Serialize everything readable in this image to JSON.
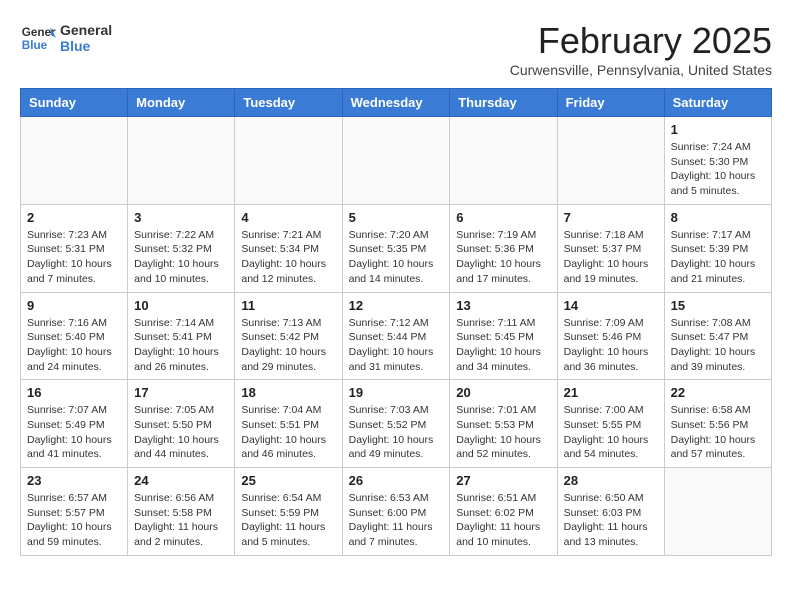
{
  "header": {
    "logo_general": "General",
    "logo_blue": "Blue",
    "month_title": "February 2025",
    "location": "Curwensville, Pennsylvania, United States"
  },
  "days_of_week": [
    "Sunday",
    "Monday",
    "Tuesday",
    "Wednesday",
    "Thursday",
    "Friday",
    "Saturday"
  ],
  "weeks": [
    [
      {
        "num": "",
        "info": ""
      },
      {
        "num": "",
        "info": ""
      },
      {
        "num": "",
        "info": ""
      },
      {
        "num": "",
        "info": ""
      },
      {
        "num": "",
        "info": ""
      },
      {
        "num": "",
        "info": ""
      },
      {
        "num": "1",
        "info": "Sunrise: 7:24 AM\nSunset: 5:30 PM\nDaylight: 10 hours and 5 minutes."
      }
    ],
    [
      {
        "num": "2",
        "info": "Sunrise: 7:23 AM\nSunset: 5:31 PM\nDaylight: 10 hours and 7 minutes."
      },
      {
        "num": "3",
        "info": "Sunrise: 7:22 AM\nSunset: 5:32 PM\nDaylight: 10 hours and 10 minutes."
      },
      {
        "num": "4",
        "info": "Sunrise: 7:21 AM\nSunset: 5:34 PM\nDaylight: 10 hours and 12 minutes."
      },
      {
        "num": "5",
        "info": "Sunrise: 7:20 AM\nSunset: 5:35 PM\nDaylight: 10 hours and 14 minutes."
      },
      {
        "num": "6",
        "info": "Sunrise: 7:19 AM\nSunset: 5:36 PM\nDaylight: 10 hours and 17 minutes."
      },
      {
        "num": "7",
        "info": "Sunrise: 7:18 AM\nSunset: 5:37 PM\nDaylight: 10 hours and 19 minutes."
      },
      {
        "num": "8",
        "info": "Sunrise: 7:17 AM\nSunset: 5:39 PM\nDaylight: 10 hours and 21 minutes."
      }
    ],
    [
      {
        "num": "9",
        "info": "Sunrise: 7:16 AM\nSunset: 5:40 PM\nDaylight: 10 hours and 24 minutes."
      },
      {
        "num": "10",
        "info": "Sunrise: 7:14 AM\nSunset: 5:41 PM\nDaylight: 10 hours and 26 minutes."
      },
      {
        "num": "11",
        "info": "Sunrise: 7:13 AM\nSunset: 5:42 PM\nDaylight: 10 hours and 29 minutes."
      },
      {
        "num": "12",
        "info": "Sunrise: 7:12 AM\nSunset: 5:44 PM\nDaylight: 10 hours and 31 minutes."
      },
      {
        "num": "13",
        "info": "Sunrise: 7:11 AM\nSunset: 5:45 PM\nDaylight: 10 hours and 34 minutes."
      },
      {
        "num": "14",
        "info": "Sunrise: 7:09 AM\nSunset: 5:46 PM\nDaylight: 10 hours and 36 minutes."
      },
      {
        "num": "15",
        "info": "Sunrise: 7:08 AM\nSunset: 5:47 PM\nDaylight: 10 hours and 39 minutes."
      }
    ],
    [
      {
        "num": "16",
        "info": "Sunrise: 7:07 AM\nSunset: 5:49 PM\nDaylight: 10 hours and 41 minutes."
      },
      {
        "num": "17",
        "info": "Sunrise: 7:05 AM\nSunset: 5:50 PM\nDaylight: 10 hours and 44 minutes."
      },
      {
        "num": "18",
        "info": "Sunrise: 7:04 AM\nSunset: 5:51 PM\nDaylight: 10 hours and 46 minutes."
      },
      {
        "num": "19",
        "info": "Sunrise: 7:03 AM\nSunset: 5:52 PM\nDaylight: 10 hours and 49 minutes."
      },
      {
        "num": "20",
        "info": "Sunrise: 7:01 AM\nSunset: 5:53 PM\nDaylight: 10 hours and 52 minutes."
      },
      {
        "num": "21",
        "info": "Sunrise: 7:00 AM\nSunset: 5:55 PM\nDaylight: 10 hours and 54 minutes."
      },
      {
        "num": "22",
        "info": "Sunrise: 6:58 AM\nSunset: 5:56 PM\nDaylight: 10 hours and 57 minutes."
      }
    ],
    [
      {
        "num": "23",
        "info": "Sunrise: 6:57 AM\nSunset: 5:57 PM\nDaylight: 10 hours and 59 minutes."
      },
      {
        "num": "24",
        "info": "Sunrise: 6:56 AM\nSunset: 5:58 PM\nDaylight: 11 hours and 2 minutes."
      },
      {
        "num": "25",
        "info": "Sunrise: 6:54 AM\nSunset: 5:59 PM\nDaylight: 11 hours and 5 minutes."
      },
      {
        "num": "26",
        "info": "Sunrise: 6:53 AM\nSunset: 6:00 PM\nDaylight: 11 hours and 7 minutes."
      },
      {
        "num": "27",
        "info": "Sunrise: 6:51 AM\nSunset: 6:02 PM\nDaylight: 11 hours and 10 minutes."
      },
      {
        "num": "28",
        "info": "Sunrise: 6:50 AM\nSunset: 6:03 PM\nDaylight: 11 hours and 13 minutes."
      },
      {
        "num": "",
        "info": ""
      }
    ]
  ]
}
